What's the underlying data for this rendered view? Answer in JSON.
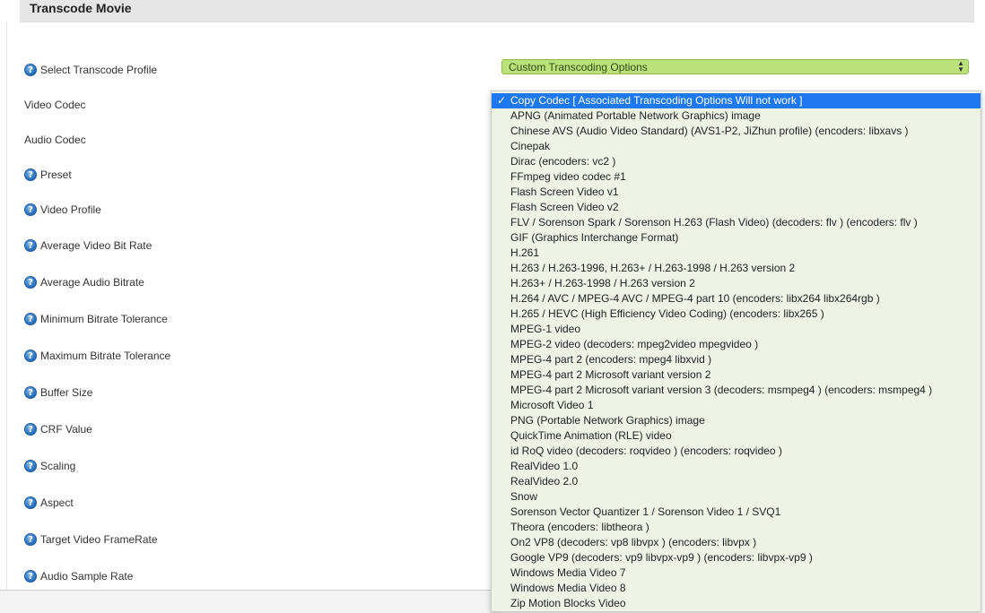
{
  "header": {
    "title": "Transcode Movie"
  },
  "form": {
    "rows": [
      {
        "label": "Select Transcode Profile",
        "help": true
      },
      {
        "label": "Video Codec",
        "help": false
      },
      {
        "label": "Audio Codec",
        "help": false
      },
      {
        "label": "Preset",
        "help": true
      },
      {
        "label": "Video Profile",
        "help": true
      },
      {
        "label": "Average Video Bit Rate",
        "help": true
      },
      {
        "label": "Average Audio Bitrate",
        "help": true
      },
      {
        "label": "Minimum Bitrate Tolerance",
        "help": true
      },
      {
        "label": "Maximum Bitrate Tolerance",
        "help": true
      },
      {
        "label": "Buffer Size",
        "help": true
      },
      {
        "label": "CRF Value",
        "help": true
      },
      {
        "label": "Scaling",
        "help": true
      },
      {
        "label": "Aspect",
        "help": true
      },
      {
        "label": "Target Video FrameRate",
        "help": true
      },
      {
        "label": "Audio Sample Rate",
        "help": true
      }
    ],
    "help_glyph": "?",
    "profile_select": {
      "value": "Custom Transcoding Options",
      "arrows": "▲▼",
      "color": "#b9e27a"
    }
  },
  "codec_dropdown": {
    "selected_mark": "✓",
    "options": [
      "Copy Codec [ Associated Transcoding Options Will not work ]",
      "APNG (Animated Portable Network Graphics) image",
      "Chinese AVS (Audio Video Standard) (AVS1-P2, JiZhun profile) (encoders: libxavs )",
      "Cinepak",
      "Dirac (encoders: vc2 )",
      "FFmpeg video codec #1",
      "Flash Screen Video v1",
      "Flash Screen Video v2",
      "FLV / Sorenson Spark / Sorenson H.263 (Flash Video) (decoders: flv ) (encoders: flv )",
      "GIF (Graphics Interchange Format)",
      "H.261",
      "H.263 / H.263-1996, H.263+ / H.263-1998 / H.263 version 2",
      "H.263+ / H.263-1998 / H.263 version 2",
      "H.264 / AVC / MPEG-4 AVC / MPEG-4 part 10 (encoders: libx264 libx264rgb )",
      "H.265 / HEVC (High Efficiency Video Coding) (encoders: libx265 )",
      "MPEG-1 video",
      "MPEG-2 video (decoders: mpeg2video mpegvideo )",
      "MPEG-4 part 2 (encoders: mpeg4 libxvid )",
      "MPEG-4 part 2 Microsoft variant version 2",
      "MPEG-4 part 2 Microsoft variant version 3 (decoders: msmpeg4 ) (encoders: msmpeg4 )",
      "Microsoft Video 1",
      "PNG (Portable Network Graphics) image",
      "QuickTime Animation (RLE) video",
      "id RoQ video (decoders: roqvideo ) (encoders: roqvideo )",
      "RealVideo 1.0",
      "RealVideo 2.0",
      "Snow",
      "Sorenson Vector Quantizer 1 / Sorenson Video 1 / SVQ1",
      "Theora (encoders: libtheora )",
      "On2 VP8 (decoders: vp8 libvpx ) (encoders: libvpx )",
      "Google VP9 (decoders: vp9 libvpx-vp9 ) (encoders: libvpx-vp9 )",
      "Windows Media Video 7",
      "Windows Media Video 8",
      "Zip Motion Blocks Video"
    ]
  }
}
